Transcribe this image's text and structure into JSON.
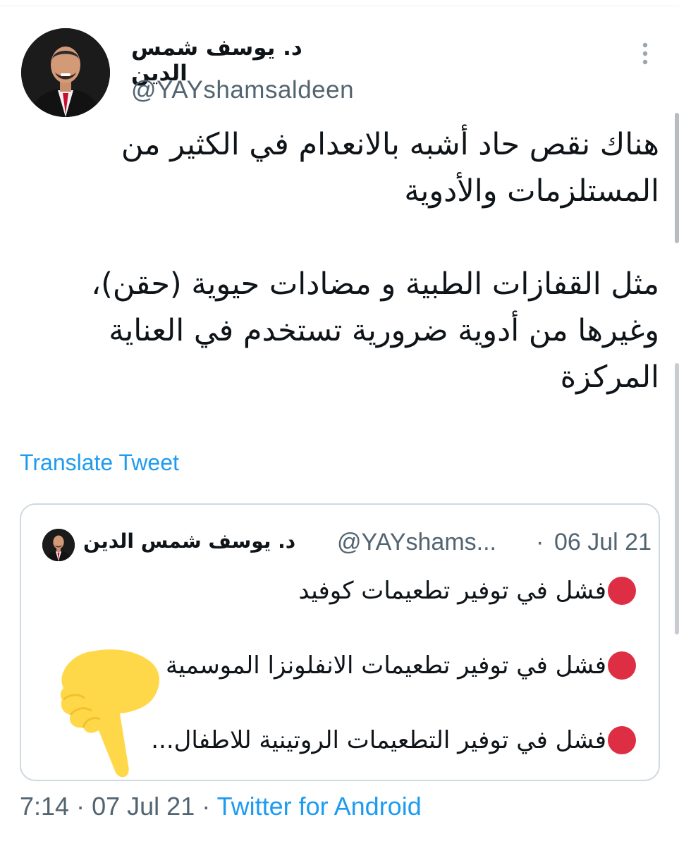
{
  "tweet": {
    "author": {
      "display_name": "د. يوسف شمس الدين",
      "handle": "@YAYshamsaldeen"
    },
    "more_icon": "vertical-ellipsis-icon",
    "paragraphs": [
      "هناك نقص حاد أشبه بالانعدام في الكثير من المستلزمات والأدوية",
      "مثل القفازات الطبية و مضادات حيوية (حقن)، وغيرها من أدوية ضرورية تستخدم في العناية المركزة"
    ],
    "translate_label": "Translate Tweet",
    "time": "7:14",
    "date": "07 Jul 21",
    "source": "Twitter for Android",
    "separator": "·"
  },
  "quoted_tweet": {
    "display_name": "د. يوسف شمس الدين",
    "handle": "@YAYshams...",
    "separator": "·",
    "date": "06 Jul 21",
    "items": [
      "فشل في توفير تطعيمات كوفيد",
      "فشل في توفير تطعيمات الانفلونزا الموسمية",
      "فشل في توفير التطعيمات الروتينية للاطفال..."
    ],
    "bullet_icon": "red-circle-emoji",
    "overlay_icon": "yellow-pointing-hand-emoji"
  },
  "colors": {
    "link": "#1d9bf0",
    "text": "#0f1419",
    "muted": "#536471",
    "border": "#cfd9de",
    "bullet": "#dd2e44",
    "hand": "#ffd84a"
  }
}
